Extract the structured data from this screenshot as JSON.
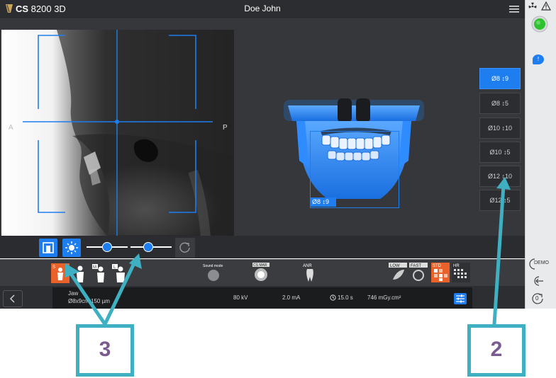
{
  "header": {
    "app_name_bold": "CS",
    "app_name_rest": " 8200 3D",
    "patient_name": "Doe John"
  },
  "viewer": {
    "label_left": "A",
    "label_right": "P",
    "fov_overlay_label": "Ø8 ↕9"
  },
  "fov_buttons": [
    {
      "label": "Ø8 ↕9",
      "active": true
    },
    {
      "label": "Ø8 ↕5",
      "active": false
    },
    {
      "label": "Ø10 ↕10",
      "active": false
    },
    {
      "label": "Ø10 ↕5",
      "active": false
    },
    {
      "label": "Ø12 ↕10",
      "active": false
    },
    {
      "label": "Ø12 ↕5",
      "active": false
    }
  ],
  "protocols": {
    "size_s": "S",
    "size_m": "M",
    "size_l": "L",
    "sound_mode": "Sound mode",
    "cs_mar": "CS MAR",
    "anr": "ANR",
    "low": "LOW",
    "fast": "FAST",
    "std": "STD",
    "hr": "HR"
  },
  "info": {
    "region": "Jaw",
    "fov_res": "Ø8x9cm  150 µm",
    "kv": "80 kV",
    "ma": "2.0 mA",
    "time": "15.0 s",
    "dose": "746 mGy.cm²"
  },
  "right_panel": {
    "demo_label": "DEMO",
    "counter": "0",
    "notification": "!"
  },
  "annotations": {
    "callout_2": "2",
    "callout_3": "3"
  },
  "colors": {
    "accent_blue": "#1e7ef0",
    "callout_teal": "#3fb0c2",
    "callout_number": "#7a5b8f",
    "status_green": "#2ec32e",
    "protocol_orange": "#e8622a"
  }
}
